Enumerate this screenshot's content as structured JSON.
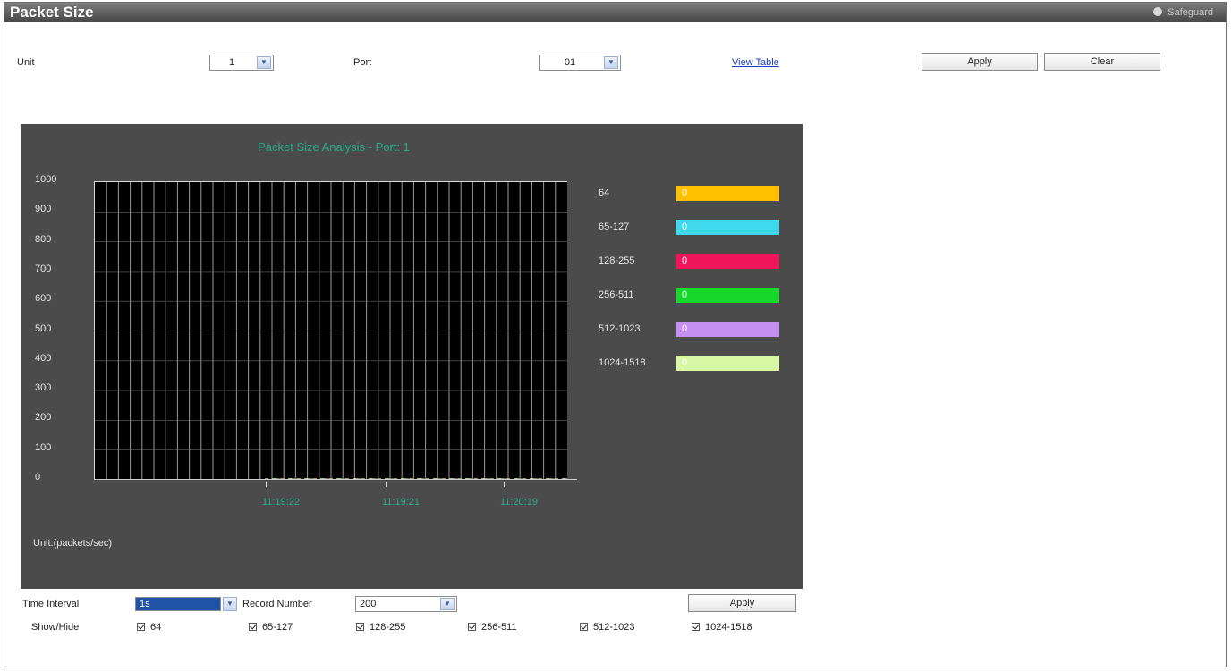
{
  "window": {
    "title": "Packet Size",
    "help_label": "Safeguard"
  },
  "controls": {
    "unit_label": "Unit",
    "unit_value": "1",
    "port_label": "Port",
    "port_value": "01",
    "view_table_link": "View Table",
    "apply_label": "Apply",
    "clear_label": "Clear"
  },
  "chart_data": {
    "type": "line",
    "title": "Packet Size Analysis - Port: 1",
    "ylabel": "Unit:(packets/sec)",
    "ylim": [
      0,
      1000
    ],
    "yticks": [
      "1000",
      "900",
      "800",
      "700",
      "600",
      "500",
      "400",
      "300",
      "200",
      "100",
      "0"
    ],
    "xticks": [
      "11:19:22",
      "11:19:21",
      "11:20:19"
    ],
    "grid": true,
    "legend_position": "right",
    "series": [
      {
        "name": "64",
        "value": "0",
        "color": "#ffc000"
      },
      {
        "name": "65-127",
        "value": "0",
        "color": "#40d8ec"
      },
      {
        "name": "128-255",
        "value": "0",
        "color": "#f0145a"
      },
      {
        "name": "256-511",
        "value": "0",
        "color": "#17d72a"
      },
      {
        "name": "512-1023",
        "value": "0",
        "color": "#c690f2"
      },
      {
        "name": "1024-1518",
        "value": "0",
        "color": "#d7f7a4"
      }
    ]
  },
  "bottom": {
    "time_interval_label": "Time Interval",
    "time_interval_value": "1s",
    "record_number_label": "Record Number",
    "record_number_value": "200",
    "apply_label": "Apply",
    "showhide_label": "Show/Hide",
    "checkboxes": [
      "64",
      "65-127",
      "128-255",
      "256-511",
      "512-1023",
      "1024-1518"
    ]
  }
}
